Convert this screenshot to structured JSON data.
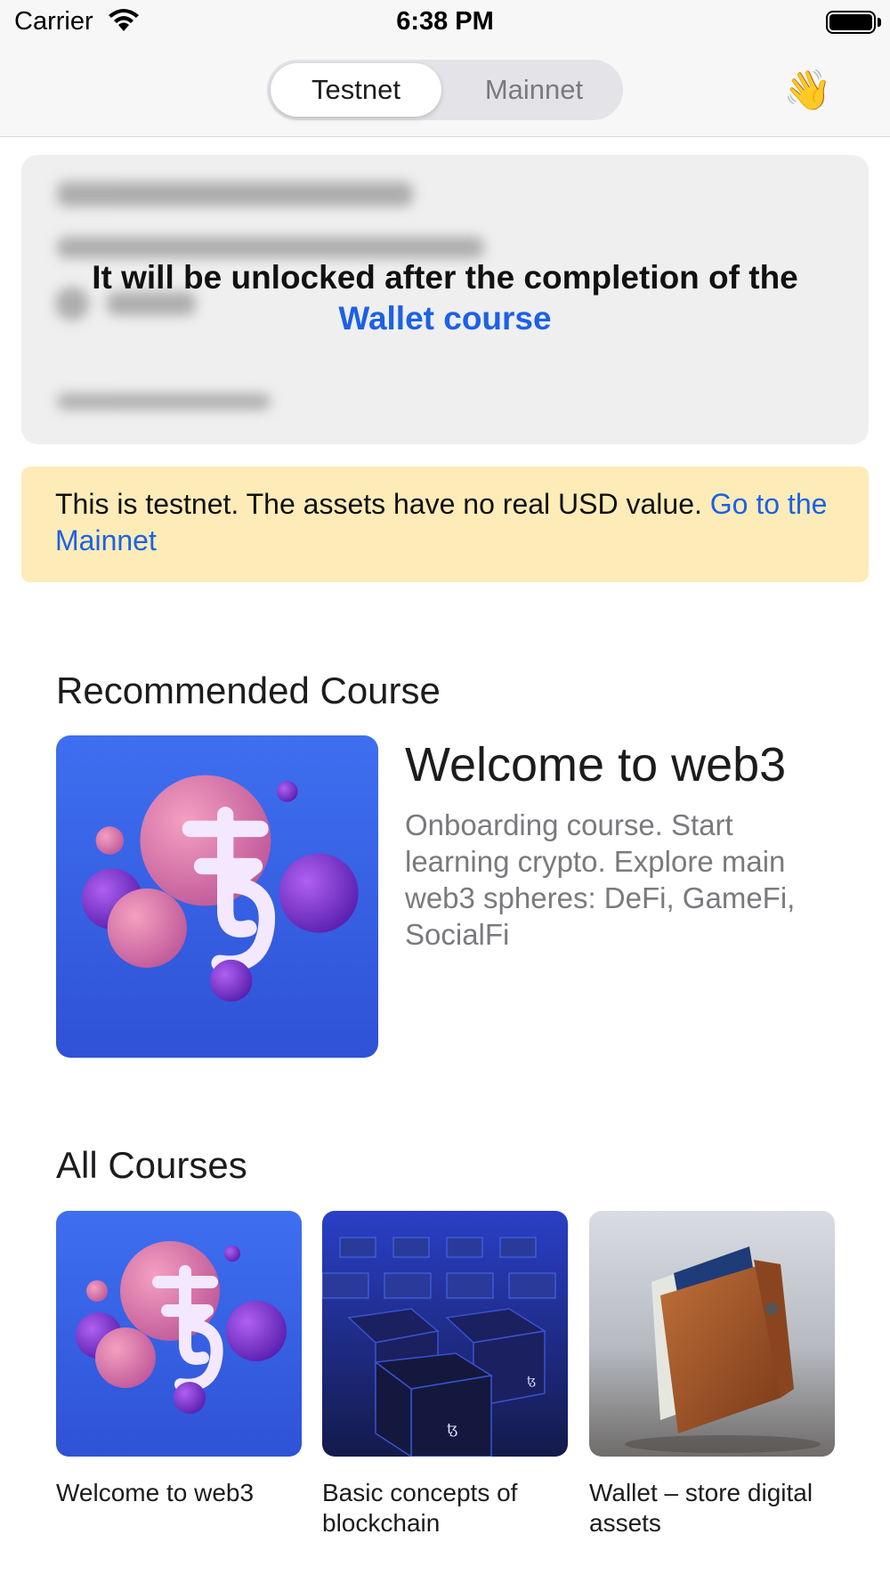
{
  "status_bar": {
    "carrier": "Carrier",
    "time": "6:38 PM"
  },
  "nav": {
    "tabs": [
      {
        "label": "Testnet",
        "selected": true
      },
      {
        "label": "Mainnet",
        "selected": false
      }
    ],
    "wave_icon": "👋"
  },
  "locked_card": {
    "message": "It will be unlocked after the completion of the",
    "link": "Wallet course"
  },
  "testnet_banner": {
    "text": "This is testnet. The assets have no real USD value.",
    "link": "Go to the Mainnet",
    "background": "#fdecb8"
  },
  "recommended": {
    "section_title": "Recommended Course",
    "course": {
      "title": "Welcome to web3",
      "description": "Onboarding course. Start learning crypto. Explore main web3 spheres: DeFi, GameFi, SocialFi",
      "image_icon": "tezos-spheres-image"
    }
  },
  "all_courses": {
    "section_title": "All Courses",
    "items": [
      {
        "title": "Welcome to web3",
        "image_icon": "tezos-spheres-image"
      },
      {
        "title": "Basic concepts of blockchain",
        "image_icon": "blockchain-cubes-image"
      },
      {
        "title": "Wallet – store digital assets",
        "image_icon": "leather-wallet-image"
      }
    ]
  },
  "colors": {
    "accent": "#1c61e6",
    "secondary_text": "#7a7a7e"
  }
}
